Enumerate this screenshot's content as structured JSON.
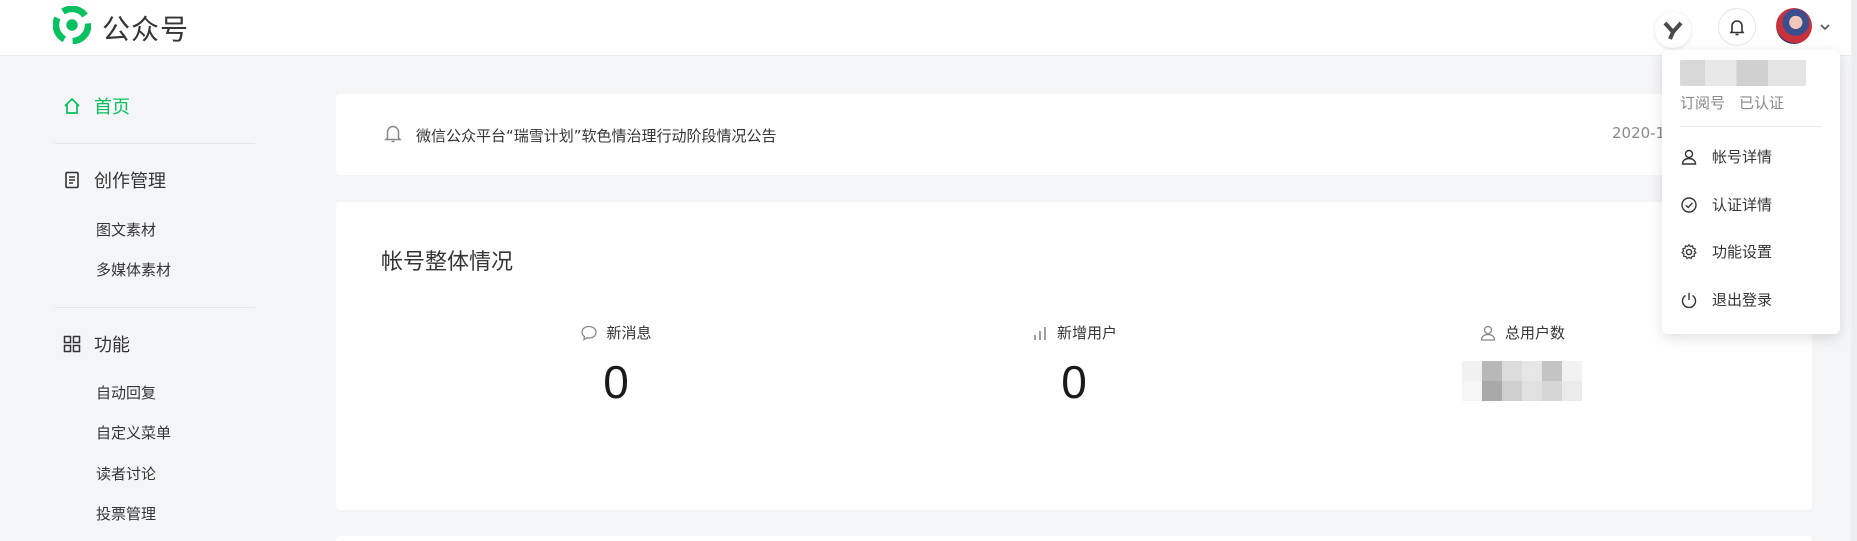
{
  "header": {
    "brand": "公众号",
    "colors": {
      "accent": "#07c160",
      "logo": "#07c160"
    }
  },
  "sidebar": {
    "home": {
      "label": "首页",
      "icon": "home-icon"
    },
    "groups": [
      {
        "label": "创作管理",
        "icon": "document-icon",
        "items": [
          "图文素材",
          "多媒体素材"
        ]
      },
      {
        "label": "功能",
        "icon": "grid-icon",
        "items": [
          "自动回复",
          "自定义菜单",
          "读者讨论",
          "投票管理"
        ]
      }
    ]
  },
  "notice": {
    "text": "微信公众平台“瑞雪计划”软色情治理行动阶段情况公告",
    "date": "2020-1"
  },
  "overview": {
    "title": "帐号整体情况",
    "stats": [
      {
        "label": "新消息",
        "value": "0",
        "icon": "chat-bubble-icon"
      },
      {
        "label": "新增用户",
        "value": "0",
        "icon": "bar-chart-icon"
      },
      {
        "label": "总用户数",
        "value": "",
        "icon": "user-icon"
      }
    ]
  },
  "account_menu": {
    "tags": [
      "订阅号",
      "已认证"
    ],
    "items": [
      {
        "label": "帐号详情",
        "icon": "user-icon"
      },
      {
        "label": "认证详情",
        "icon": "check-circle-icon"
      },
      {
        "label": "功能设置",
        "icon": "gear-icon"
      },
      {
        "label": "退出登录",
        "icon": "power-icon"
      }
    ]
  }
}
